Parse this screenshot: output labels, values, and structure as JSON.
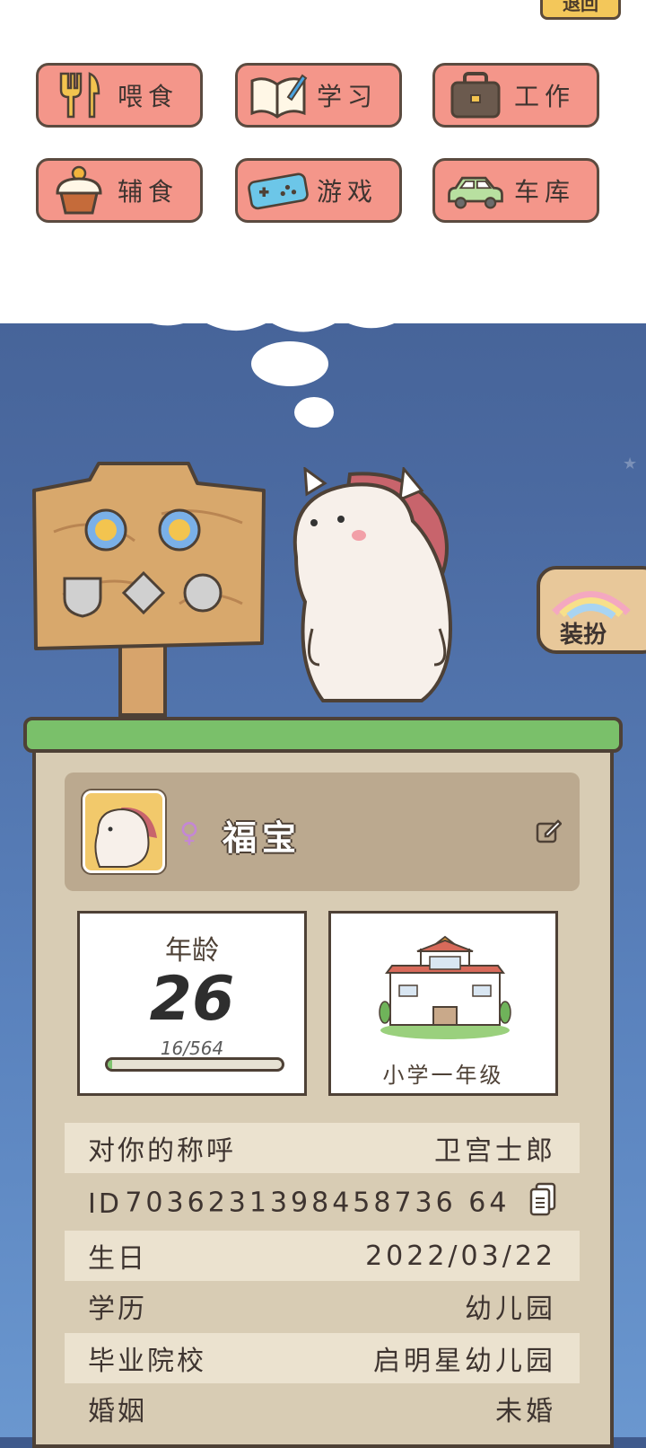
{
  "header": {
    "exit_label": "退回"
  },
  "menu": [
    {
      "id": "feed",
      "label": "喂食",
      "icon": "fork-knife-icon"
    },
    {
      "id": "study",
      "label": "学习",
      "icon": "book-icon"
    },
    {
      "id": "work",
      "label": "工作",
      "icon": "briefcase-icon"
    },
    {
      "id": "snack",
      "label": "辅食",
      "icon": "cupcake-icon"
    },
    {
      "id": "game",
      "label": "游戏",
      "icon": "gamepad-icon"
    },
    {
      "id": "garage",
      "label": "车库",
      "icon": "car-icon"
    }
  ],
  "dress_button": {
    "label": "装扮",
    "icon": "rainbow-icon"
  },
  "profile": {
    "gender_symbol": "♀",
    "name": "福宝"
  },
  "age_card": {
    "label": "年龄",
    "value": "26",
    "progress_text": "16/564",
    "progress_fraction": 0.028
  },
  "school_card": {
    "grade": "小学一年级",
    "icon": "school-building-icon"
  },
  "info_rows": [
    {
      "label": "对你的称呼",
      "value": "卫宫士郎"
    },
    {
      "label": "ID",
      "value": "7036231398458736 64"
    },
    {
      "label": "生日",
      "value": "2022/03/22"
    },
    {
      "label": "学历",
      "value": "幼儿园"
    },
    {
      "label": "毕业院校",
      "value": "启明星幼儿园"
    },
    {
      "label": "婚姻",
      "value": "未婚"
    }
  ],
  "colors": {
    "button_bg": "#f4968a",
    "panel_bg": "#d8ccb4",
    "sky_top": "#3f5a8c",
    "grass": "#7ac06a"
  }
}
